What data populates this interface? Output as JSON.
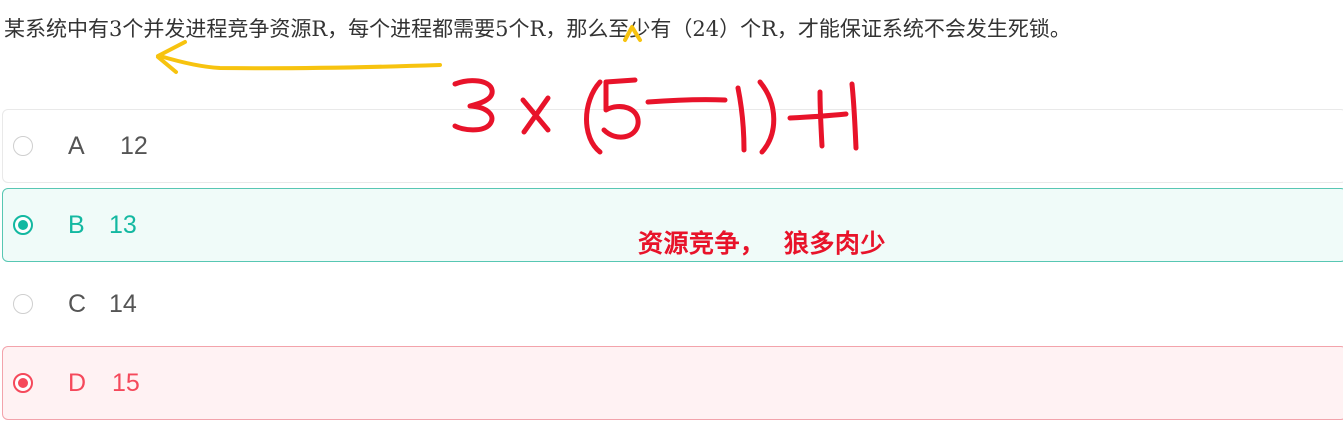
{
  "question": {
    "text": "某系统中有3个并发进程竞争资源R，每个进程都需要5个R，那么至少有（24）个R，才能保证系统不会发生死锁。"
  },
  "options": [
    {
      "letter": "A",
      "text": "12",
      "state": "unselected"
    },
    {
      "letter": "B",
      "text": "13",
      "state": "correct"
    },
    {
      "letter": "C",
      "text": "14",
      "state": "unselected"
    },
    {
      "letter": "D",
      "text": "15",
      "state": "wrong"
    }
  ],
  "handwriting": {
    "formula": "3x(5-1)+1",
    "formula_color": "#e8132a",
    "arrow_color": "#f7c30f"
  },
  "note": {
    "text": "资源竞争，  狼多肉少"
  },
  "colors": {
    "correct": "#13b8a1",
    "wrong": "#f5495b",
    "text": "#555555"
  }
}
